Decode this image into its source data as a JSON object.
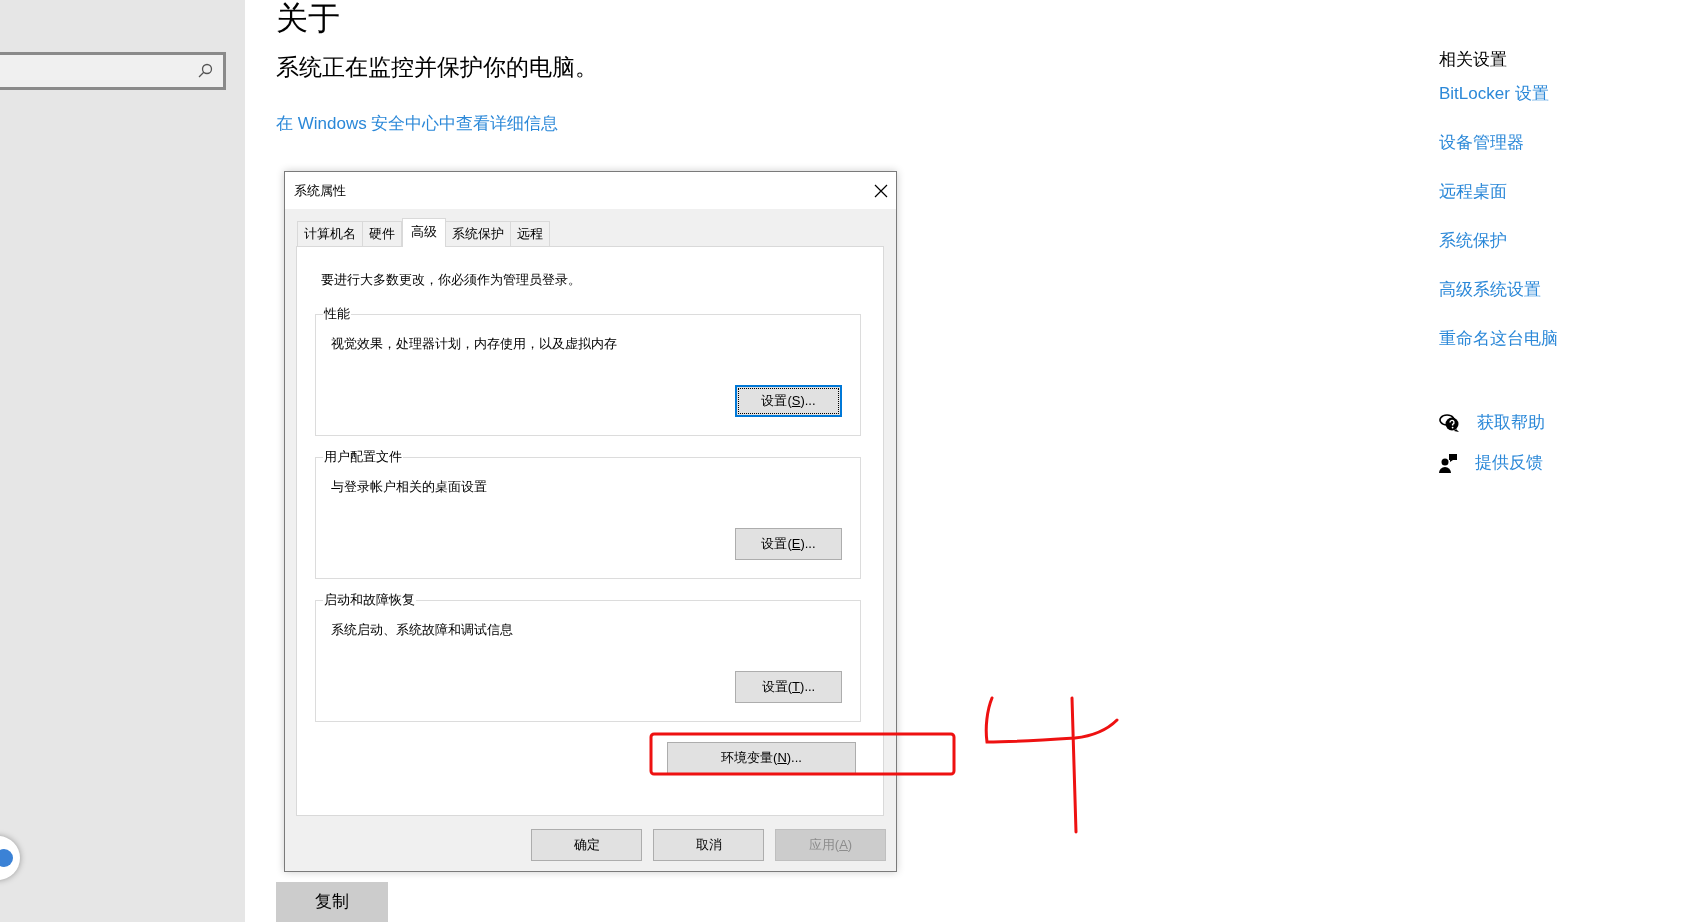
{
  "page": {
    "title": "关于",
    "security_status": "系统正在监控并保护你的电脑。",
    "security_link": "在 Windows 安全中心中查看详细信息",
    "copy_button": "复制"
  },
  "dialog": {
    "title": "系统属性",
    "tabs": [
      {
        "label": "计算机名",
        "selected": false
      },
      {
        "label": "硬件",
        "selected": false
      },
      {
        "label": "高级",
        "selected": true
      },
      {
        "label": "系统保护",
        "selected": false
      },
      {
        "label": "远程",
        "selected": false
      }
    ],
    "admin_note": "要进行大多数更改，你必须作为管理员登录。",
    "groups": [
      {
        "title": "性能",
        "description": "视觉效果，处理器计划，内存使用，以及虚拟内存",
        "button": [
          "设置(",
          "S",
          ")..."
        ],
        "focused": true
      },
      {
        "title": "用户配置文件",
        "description": "与登录帐户相关的桌面设置",
        "button": [
          "设置(",
          "E",
          ")..."
        ],
        "focused": false
      },
      {
        "title": "启动和故障恢复",
        "description": "系统启动、系统故障和调试信息",
        "button": [
          "设置(",
          "T",
          ")..."
        ],
        "focused": false
      }
    ],
    "env_button": [
      "环境变量(",
      "N",
      ")..."
    ],
    "buttons": [
      {
        "label": [
          "确定"
        ],
        "disabled": false
      },
      {
        "label": [
          "取消"
        ],
        "disabled": false
      },
      {
        "label": [
          "应用(",
          "A",
          ")"
        ],
        "disabled": true
      }
    ]
  },
  "related": {
    "title": "相关设置",
    "links": [
      "BitLocker 设置",
      "设备管理器",
      "远程桌面",
      "系统保护",
      "高级系统设置",
      "重命名这台电脑"
    ]
  },
  "help": [
    {
      "kind": "help",
      "label": "获取帮助"
    },
    {
      "kind": "feedback",
      "label": "提供反馈"
    }
  ]
}
